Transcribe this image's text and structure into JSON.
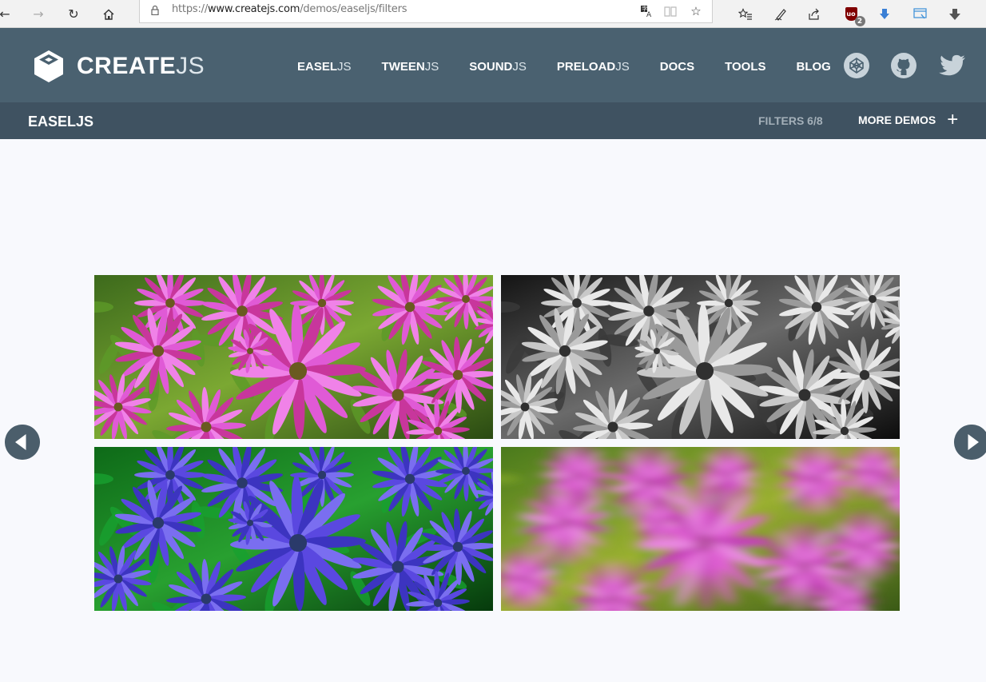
{
  "browser": {
    "url_scheme": "https://",
    "url_host": "www.createjs.com",
    "url_path": "/demos/easeljs/filters",
    "extension_badge": "2",
    "icons": [
      "back-icon",
      "forward-icon",
      "refresh-icon",
      "home-icon",
      "lock-icon",
      "translate-icon",
      "reading-view-icon",
      "favorite-star-icon",
      "favorites-list-icon",
      "pen-icon",
      "share-icon",
      "ublock-icon",
      "download-extension-icon",
      "screenshot-icon",
      "download-arrow-icon"
    ]
  },
  "header": {
    "logo_bold": "CREATE",
    "logo_light": "JS",
    "nav": [
      {
        "bold": "EASEL",
        "light": "JS"
      },
      {
        "bold": "TWEEN",
        "light": "JS"
      },
      {
        "bold": "SOUND",
        "light": "JS"
      },
      {
        "bold": "PRELOAD",
        "light": "JS"
      },
      {
        "bold": "DOCS",
        "light": ""
      },
      {
        "bold": "TOOLS",
        "light": ""
      },
      {
        "bold": "BLOG",
        "light": ""
      }
    ]
  },
  "subheader": {
    "title": "EASELJS",
    "counter": "FILTERS 6/8",
    "more_label": "MORE DEMOS",
    "more_icon": "+"
  },
  "demo": {
    "panels": [
      {
        "name": "original",
        "tint": "#d648c8"
      },
      {
        "name": "grayscale",
        "tint": "#bbbbbb"
      },
      {
        "name": "blue-tint",
        "tint": "#5046d8"
      },
      {
        "name": "blur",
        "tint": "#d540c4"
      }
    ]
  },
  "colors": {
    "header": "#4a6170",
    "subheader": "#3f5261",
    "page_bg": "#f8f9fd",
    "arrow": "#4b5e6b"
  }
}
